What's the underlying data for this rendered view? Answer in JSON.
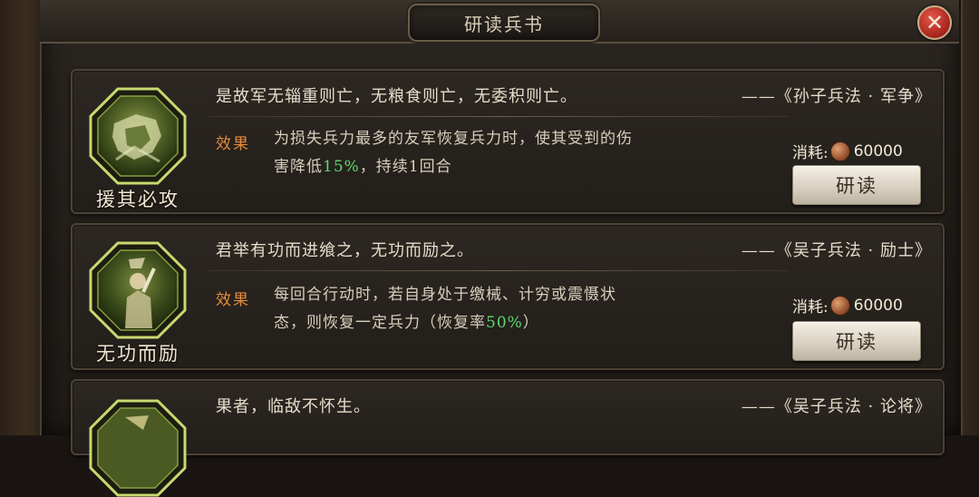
{
  "dialog": {
    "title": "研读兵书",
    "close_icon": "close-icon"
  },
  "cards": [
    {
      "skill_name": "援其必攻",
      "icon": "warrior-portrait-icon",
      "quote": "是故军无辎重则亡，无粮食则亡，无委积则亡。",
      "source": "——《孙子兵法 · 军争》",
      "effect_label": "效果",
      "effect_line1": "为损失兵力最多的友军恢复兵力时，使其受到的伤",
      "effect_line2_pre": "害降低",
      "effect_highlight": "15%",
      "effect_line2_post": "，持续1回合",
      "cost_label": "消耗:",
      "cost_value": "60000",
      "button_label": "研读"
    },
    {
      "skill_name": "无功而励",
      "icon": "swordsman-portrait-icon",
      "quote": "君举有功而进飨之，无功而励之。",
      "source": "——《吴子兵法 · 励士》",
      "effect_label": "效果",
      "effect_line1": "每回合行动时，若自身处于缴械、计穷或震慑状",
      "effect_line2_pre": "态，则恢复一定兵力（恢复率",
      "effect_highlight": "50%",
      "effect_line2_post": "）",
      "cost_label": "消耗:",
      "cost_value": "60000",
      "button_label": "研读"
    },
    {
      "skill_name": "",
      "icon": "warrior-portrait-icon",
      "quote": "果者，临敌不怀生。",
      "source": "——《吴子兵法 · 论将》"
    }
  ],
  "colors": {
    "effect_label": "#e38a3a",
    "highlight": "#5fd86d",
    "icon_border": "#c8d870"
  }
}
